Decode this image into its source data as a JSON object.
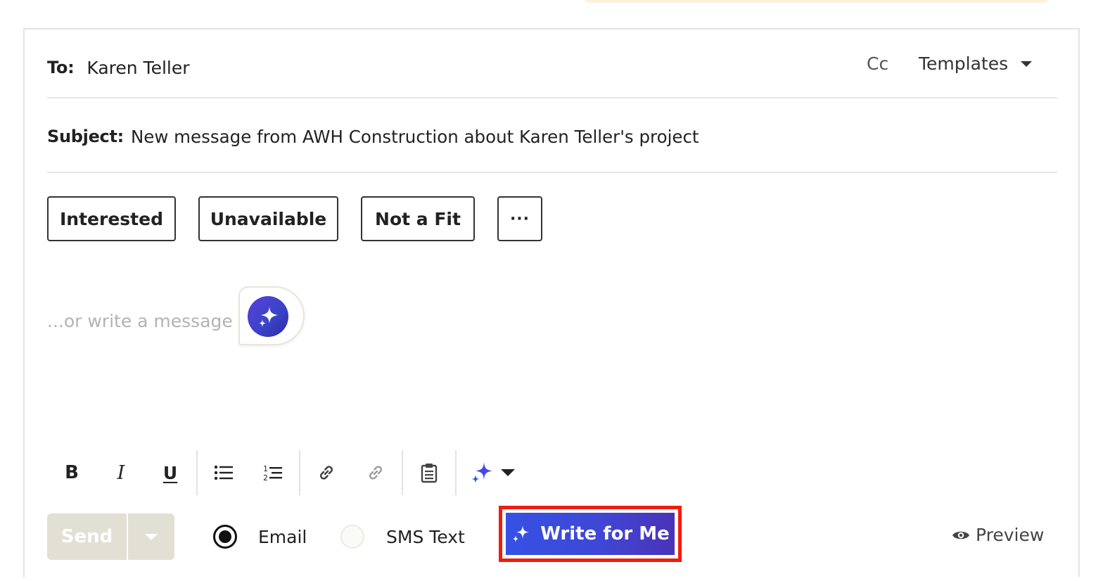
{
  "header": {
    "to_label": "To:",
    "to_value": "Karen Teller",
    "cc_label": "Cc",
    "templates_label": "Templates",
    "subject_label": "Subject:",
    "subject_value": "New message from AWH Construction about Karen Teller's project"
  },
  "quick_replies": {
    "interested": "Interested",
    "unavailable": "Unavailable",
    "not_a_fit": "Not a Fit",
    "more": "···"
  },
  "message": {
    "placeholder": "...or write a message"
  },
  "toolbar": {
    "bold": "B",
    "italic": "I",
    "underline": "U"
  },
  "footer": {
    "send_label": "Send",
    "channel_email": "Email",
    "channel_sms": "SMS Text",
    "selected_channel": "Email",
    "write_for_me": "Write for Me",
    "preview": "Preview"
  },
  "colors": {
    "ai_gradient_start": "#3551e4",
    "ai_gradient_end": "#4a33b8",
    "highlight_border": "#f21c0c",
    "send_disabled": "#e2dfd5"
  }
}
